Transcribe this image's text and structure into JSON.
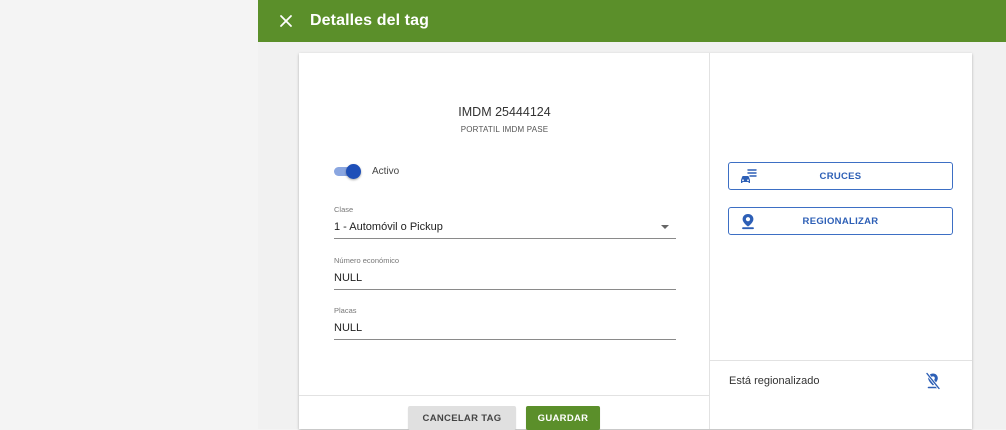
{
  "header": {
    "title": "Detalles del tag",
    "close_icon": "close-icon"
  },
  "tag": {
    "id": "IMDM 25444124",
    "description": "PORTATIL IMDM PASE"
  },
  "toggle": {
    "label": "Activo",
    "checked": true
  },
  "fields": {
    "clase": {
      "label": "Clase",
      "value": "1 - Automóvil o Pickup"
    },
    "numero": {
      "label": "Número económico",
      "value": "NULL"
    },
    "placas": {
      "label": "Placas",
      "value": "NULL"
    }
  },
  "footer": {
    "cancel_label": "CANCELAR TAG",
    "save_label": "GUARDAR"
  },
  "actions": {
    "cruces": {
      "label": "CRUCES",
      "icon": "car-list-icon"
    },
    "regionalizar": {
      "label": "REGIONALIZAR",
      "icon": "location-pin-icon"
    }
  },
  "status": {
    "text": "Está regionalizado",
    "icon": "location-off-icon"
  },
  "colors": {
    "brand_green": "#5b8f2a",
    "accent_blue": "#2d5fb6",
    "toggle_on": "#1e4fb8"
  }
}
